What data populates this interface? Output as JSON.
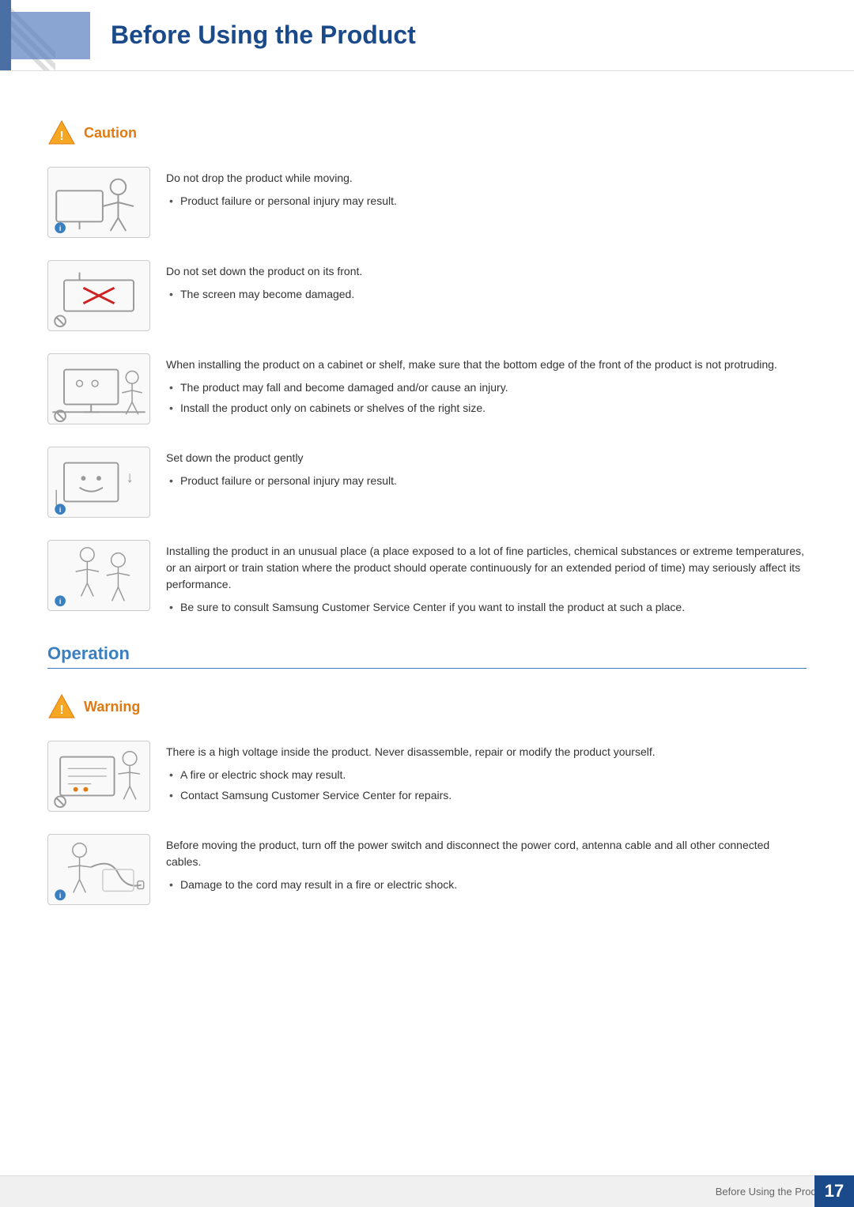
{
  "header": {
    "title": "Before Using the Product",
    "accent_color": "#4a6fa5"
  },
  "caution_section": {
    "label": "Caution",
    "items": [
      {
        "id": "caution-1",
        "main_text": "Do not drop the product while moving.",
        "bullets": [
          "Product failure or personal injury may result."
        ]
      },
      {
        "id": "caution-2",
        "main_text": "Do not set down the product on its front.",
        "bullets": [
          "The screen may become damaged."
        ]
      },
      {
        "id": "caution-3",
        "main_text": "When installing the product on a cabinet or shelf, make sure that the bottom edge of the front of the product is not protruding.",
        "bullets": [
          "The product may fall and become damaged and/or cause an injury.",
          "Install the product only on cabinets or shelves of the right size."
        ]
      },
      {
        "id": "caution-4",
        "main_text": "Set down the product gently",
        "bullets": [
          "Product failure or personal injury may result."
        ]
      },
      {
        "id": "caution-5",
        "main_text": "Installing the product in an unusual place (a place exposed to a lot of fine particles, chemical substances or extreme temperatures, or an airport or train station where the product should operate continuously for an extended period of time) may seriously affect its performance.",
        "bullets": [
          "Be sure to consult Samsung Customer Service Center if you want to install the product at such a place."
        ]
      }
    ]
  },
  "operation_section": {
    "label": "Operation"
  },
  "warning_section": {
    "label": "Warning",
    "items": [
      {
        "id": "warning-1",
        "main_text": "There is a high voltage inside the product. Never disassemble, repair or modify the product yourself.",
        "bullets": [
          "A fire or electric shock may result.",
          "Contact Samsung Customer Service Center for repairs."
        ]
      },
      {
        "id": "warning-2",
        "main_text": "Before moving the product, turn off the power switch and disconnect the power cord, antenna cable and all other connected cables.",
        "bullets": [
          "Damage to the cord may result in a fire or electric shock."
        ]
      }
    ]
  },
  "footer": {
    "section_label": "Before Using the Product",
    "page_number": "17"
  }
}
